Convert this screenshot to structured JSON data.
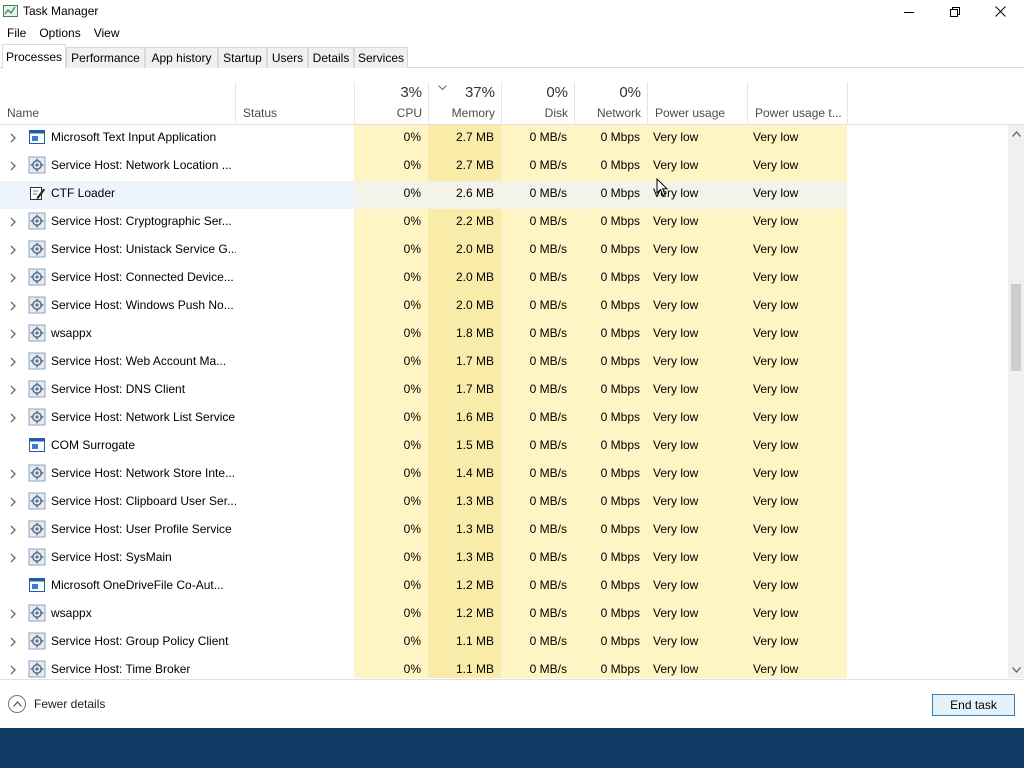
{
  "window": {
    "title": "Task Manager"
  },
  "menu": {
    "items": [
      "File",
      "Options",
      "View"
    ]
  },
  "tabs": [
    {
      "label": "Processes",
      "active": true
    },
    {
      "label": "Performance"
    },
    {
      "label": "App history"
    },
    {
      "label": "Startup"
    },
    {
      "label": "Users"
    },
    {
      "label": "Details"
    },
    {
      "label": "Services"
    }
  ],
  "columns": {
    "name": "Name",
    "status": "Status",
    "cpu": {
      "label": "CPU",
      "pct": "3%"
    },
    "memory": {
      "label": "Memory",
      "pct": "37%"
    },
    "disk": {
      "label": "Disk",
      "pct": "0%"
    },
    "network": {
      "label": "Network",
      "pct": "0%"
    },
    "power": "Power usage",
    "power_trend": "Power usage t..."
  },
  "rows": [
    {
      "name": "Microsoft Text Input Application",
      "icon": "app-window-icon",
      "expand": true,
      "cpu": "0%",
      "mem": "2.7 MB",
      "disk": "0 MB/s",
      "net": "0 Mbps",
      "power": "Very low",
      "power_trend": "Very low"
    },
    {
      "name": "Service Host: Network Location ...",
      "icon": "gear-icon",
      "expand": true,
      "cpu": "0%",
      "mem": "2.7 MB",
      "disk": "0 MB/s",
      "net": "0 Mbps",
      "power": "Very low",
      "power_trend": "Very low"
    },
    {
      "name": "CTF Loader",
      "icon": "pen-icon",
      "expand": false,
      "highlight": true,
      "cpu": "0%",
      "mem": "2.6 MB",
      "disk": "0 MB/s",
      "net": "0 Mbps",
      "power": "Very low",
      "power_trend": "Very low"
    },
    {
      "name": "Service Host: Cryptographic Ser...",
      "icon": "gear-icon",
      "expand": true,
      "cpu": "0%",
      "mem": "2.2 MB",
      "disk": "0 MB/s",
      "net": "0 Mbps",
      "power": "Very low",
      "power_trend": "Very low"
    },
    {
      "name": "Service Host: Unistack Service G...",
      "icon": "gear-icon",
      "expand": true,
      "cpu": "0%",
      "mem": "2.0 MB",
      "disk": "0 MB/s",
      "net": "0 Mbps",
      "power": "Very low",
      "power_trend": "Very low"
    },
    {
      "name": "Service Host: Connected Device...",
      "icon": "gear-icon",
      "expand": true,
      "cpu": "0%",
      "mem": "2.0 MB",
      "disk": "0 MB/s",
      "net": "0 Mbps",
      "power": "Very low",
      "power_trend": "Very low"
    },
    {
      "name": "Service Host: Windows Push No...",
      "icon": "gear-icon",
      "expand": true,
      "cpu": "0%",
      "mem": "2.0 MB",
      "disk": "0 MB/s",
      "net": "0 Mbps",
      "power": "Very low",
      "power_trend": "Very low"
    },
    {
      "name": "wsappx",
      "icon": "gear-icon",
      "expand": true,
      "cpu": "0%",
      "mem": "1.8 MB",
      "disk": "0 MB/s",
      "net": "0 Mbps",
      "power": "Very low",
      "power_trend": "Very low"
    },
    {
      "name": "Service Host: Web Account Ma...",
      "icon": "gear-icon",
      "expand": true,
      "cpu": "0%",
      "mem": "1.7 MB",
      "disk": "0 MB/s",
      "net": "0 Mbps",
      "power": "Very low",
      "power_trend": "Very low"
    },
    {
      "name": "Service Host: DNS Client",
      "icon": "gear-icon",
      "expand": true,
      "cpu": "0%",
      "mem": "1.7 MB",
      "disk": "0 MB/s",
      "net": "0 Mbps",
      "power": "Very low",
      "power_trend": "Very low"
    },
    {
      "name": "Service Host: Network List Service",
      "icon": "gear-icon",
      "expand": true,
      "cpu": "0%",
      "mem": "1.6 MB",
      "disk": "0 MB/s",
      "net": "0 Mbps",
      "power": "Very low",
      "power_trend": "Very low"
    },
    {
      "name": "COM Surrogate",
      "icon": "app-window-icon",
      "expand": false,
      "cpu": "0%",
      "mem": "1.5 MB",
      "disk": "0 MB/s",
      "net": "0 Mbps",
      "power": "Very low",
      "power_trend": "Very low"
    },
    {
      "name": "Service Host: Network Store Inte...",
      "icon": "gear-icon",
      "expand": true,
      "cpu": "0%",
      "mem": "1.4 MB",
      "disk": "0 MB/s",
      "net": "0 Mbps",
      "power": "Very low",
      "power_trend": "Very low"
    },
    {
      "name": "Service Host: Clipboard User Ser...",
      "icon": "gear-icon",
      "expand": true,
      "cpu": "0%",
      "mem": "1.3 MB",
      "disk": "0 MB/s",
      "net": "0 Mbps",
      "power": "Very low",
      "power_trend": "Very low"
    },
    {
      "name": "Service Host: User Profile Service",
      "icon": "gear-icon",
      "expand": true,
      "cpu": "0%",
      "mem": "1.3 MB",
      "disk": "0 MB/s",
      "net": "0 Mbps",
      "power": "Very low",
      "power_trend": "Very low"
    },
    {
      "name": "Service Host: SysMain",
      "icon": "gear-icon",
      "expand": true,
      "cpu": "0%",
      "mem": "1.3 MB",
      "disk": "0 MB/s",
      "net": "0 Mbps",
      "power": "Very low",
      "power_trend": "Very low"
    },
    {
      "name": "Microsoft OneDriveFile Co-Aut...",
      "icon": "app-window-icon",
      "expand": false,
      "cpu": "0%",
      "mem": "1.2 MB",
      "disk": "0 MB/s",
      "net": "0 Mbps",
      "power": "Very low",
      "power_trend": "Very low"
    },
    {
      "name": "wsappx",
      "icon": "gear-icon",
      "expand": true,
      "cpu": "0%",
      "mem": "1.2 MB",
      "disk": "0 MB/s",
      "net": "0 Mbps",
      "power": "Very low",
      "power_trend": "Very low"
    },
    {
      "name": "Service Host: Group Policy Client",
      "icon": "gear-icon",
      "expand": true,
      "cpu": "0%",
      "mem": "1.1 MB",
      "disk": "0 MB/s",
      "net": "0 Mbps",
      "power": "Very low",
      "power_trend": "Very low"
    },
    {
      "name": "Service Host: Time Broker",
      "icon": "gear-icon",
      "expand": true,
      "cpu": "0%",
      "mem": "1.1 MB",
      "disk": "0 MB/s",
      "net": "0 Mbps",
      "power": "Very low",
      "power_trend": "Very low"
    }
  ],
  "footer": {
    "fewer_details": "Fewer details",
    "end_task": "End task"
  },
  "colors": {
    "heat_light": "#fff4c4",
    "heat_medium": "#f9eca8",
    "accent": "#3c7fb1",
    "desktop": "#103a63"
  }
}
